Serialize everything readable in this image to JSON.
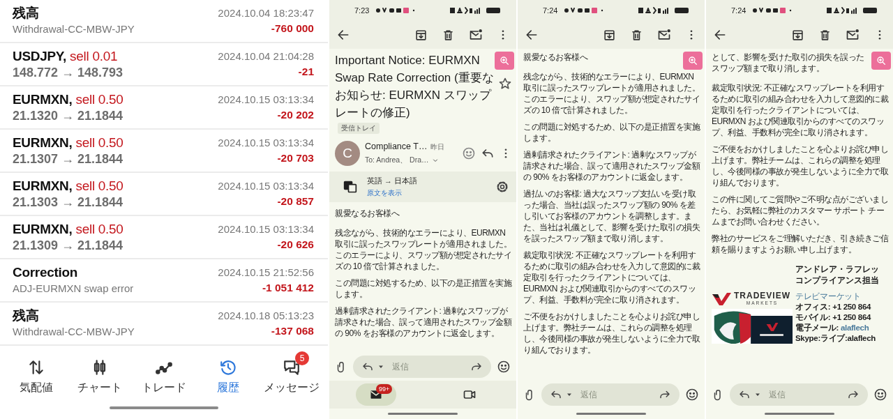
{
  "trading_app": {
    "rows": [
      {
        "kind": "balance",
        "title": "残高",
        "memo": "Withdrawal-CC-MBW-JPY",
        "time": "2024.10.04 18:23:47",
        "amount": "-760 000"
      },
      {
        "kind": "trade",
        "symbol": "USDJPY,",
        "side": "sell 0.01",
        "prices": "148.772 → 148.793",
        "time": "2024.10.04 21:04:28",
        "amount": "-21"
      },
      {
        "kind": "trade",
        "symbol": "EURMXN,",
        "side": "sell 0.50",
        "prices": "21.1320 → 21.1844",
        "time": "2024.10.15 03:13:34",
        "amount": "-20 202"
      },
      {
        "kind": "trade",
        "symbol": "EURMXN,",
        "side": "sell 0.50",
        "prices": "21.1307 → 21.1844",
        "time": "2024.10.15 03:13:34",
        "amount": "-20 703"
      },
      {
        "kind": "trade",
        "symbol": "EURMXN,",
        "side": "sell 0.50",
        "prices": "21.1303 → 21.1844",
        "time": "2024.10.15 03:13:34",
        "amount": "-20 857"
      },
      {
        "kind": "trade",
        "symbol": "EURMXN,",
        "side": "sell 0.50",
        "prices": "21.1309 → 21.1844",
        "time": "2024.10.15 03:13:34",
        "amount": "-20 626"
      },
      {
        "kind": "balance",
        "title": "Correction",
        "memo": "ADJ-EURMXN swap error",
        "time": "2024.10.15 21:52:56",
        "amount": "-1 051 412"
      },
      {
        "kind": "balance",
        "title": "残高",
        "memo": "Withdrawal-CC-MBW-JPY",
        "time": "2024.10.18 05:13:23",
        "amount": "-137 068"
      }
    ],
    "nav": [
      {
        "label": "気配値",
        "selected": false
      },
      {
        "label": "チャート",
        "selected": false
      },
      {
        "label": "トレード",
        "selected": false
      },
      {
        "label": "履歴",
        "selected": true
      },
      {
        "label": "メッセージ",
        "selected": false,
        "badge": "5"
      }
    ]
  },
  "email_screens": [
    {
      "status_time": "7:23",
      "subject": "Important Notice: EURMXN Swap Rate Correction (重要なお知らせ: EURMXN スワップレートの修正)",
      "subject_label": "受信トレイ",
      "sender": {
        "initial": "C",
        "name": "Compliance T…",
        "date": "昨日",
        "to": "To: Andrea、 Dra…"
      },
      "translation": {
        "languages": "英語 → 日本語",
        "link": "原文を表示"
      },
      "paragraphs": [
        "親愛なるお客様へ",
        "残念ながら、技術的なエラーにより、EURMXN 取引に誤ったスワップレートが適用されました。このエラーにより、スワップ額が想定されたサイズの 10 倍で計算されました。",
        "この問題に対処するため、以下の是正措置を実施します。",
        "過剰請求されたクライアント: 過剰なスワップが請求された場合、誤って適用されたスワップ金額の 90% をお客様のアカウントに返金します。"
      ],
      "reply_placeholder": "返信",
      "bottom_nav": [
        {
          "kind": "mail",
          "selected": true,
          "badge": "99+"
        },
        {
          "kind": "video",
          "selected": false
        }
      ]
    },
    {
      "status_time": "7:24",
      "paragraphs": [
        "親愛なるお客様へ",
        "残念ながら、技術的なエラーにより、EURMXN 取引に誤ったスワップレートが適用されました。このエラーにより、スワップ額が想定されたサイズの 10 倍で計算されました。",
        "この問題に対処するため、以下の是正措置を実施します。",
        "過剰請求されたクライアント: 過剰なスワップが請求された場合、誤って適用されたスワップ金額の 90% をお客様のアカウントに返金します。",
        "過払いのお客様: 過大なスワップ支払いを受け取った場合、当社は誤ったスワップ額の 90% を差し引いてお客様のアカウントを調整します。また、当社は礼儀として、影響を受けた取引の損失を誤ったスワップ額まで取り消します。",
        "裁定取引状況: 不正確なスワップレートを利用するために取引の組み合わせを入力して意図的に裁定取引を行ったクライアントについては、EURMXN および関連取引からのすべてのスワップ、利益、手数料が完全に取り消されます。",
        "ご不便をおかけしましたことを心よりお詫び申し上げます。弊社チームは、これらの調整を処理し、今後同様の事故が発生しないように全力で取り組んでおります。"
      ],
      "reply_placeholder": "返信"
    },
    {
      "status_time": "7:24",
      "paragraphs": [
        "として、影響を受けた取引の損失を誤ったスワップ額まで取り消します。",
        "裁定取引状況: 不正確なスワップレートを利用するために取引の組み合わせを入力して意図的に裁定取引を行ったクライアントについては、EURMXN および関連取引からのすべてのスワップ、利益、手数料が完全に取り消されます。",
        "ご不便をおかけしましたことを心よりお詫び申し上げます。弊社チームは、これらの調整を処理し、今後同様の事故が発生しないように全力で取り組んでおります。",
        "この件に関してご質問やご不明な点がございましたら、お気軽に弊社のカスタマー サポート チームまでお問い合わせください。",
        "弊社のサービスをご理解いただき、引き続きご信頼を賜りますようお願い申し上げます。"
      ],
      "signature": {
        "name": "アンドレア・ラフレッ",
        "role": "コンプライアンス担当",
        "logo": "TRADEVIEW",
        "logo_sub": "MARKETS",
        "company": "テレビマーケット",
        "lines": [
          {
            "kind": "text",
            "text": "オフィス: +1 250 864"
          },
          {
            "kind": "text",
            "text": "モバイル: +1 250 864"
          },
          {
            "kind": "email",
            "label": "電子メール: ",
            "link": "alaflech"
          },
          {
            "kind": "text",
            "text": "Skype:ライブ:alaflech"
          }
        ]
      },
      "reply_placeholder": "返信"
    }
  ]
}
